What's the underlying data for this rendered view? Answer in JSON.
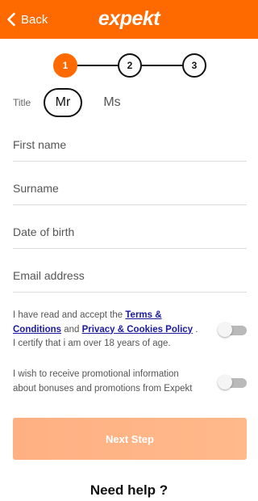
{
  "header": {
    "back_label": "Back",
    "logo_text": "expekt",
    "brand_color": "#ff6a00"
  },
  "stepper": {
    "steps": [
      "1",
      "2",
      "3"
    ],
    "current": 1
  },
  "title_field": {
    "label": "Title",
    "options": [
      "Mr",
      "Ms"
    ],
    "selected": "Mr"
  },
  "form": {
    "first_name": {
      "placeholder": "First name",
      "value": ""
    },
    "surname": {
      "placeholder": "Surname",
      "value": ""
    },
    "date_of_birth": {
      "placeholder": "Date of birth",
      "value": ""
    },
    "email": {
      "placeholder": "Email address",
      "value": ""
    }
  },
  "consents": {
    "terms": {
      "text_before": "I have read and accept the ",
      "link1": "Terms & Conditions",
      "text_mid": " and ",
      "link2": "Privacy & Cookies Policy",
      "text_after": " . I certify that i am over 18 years of age.",
      "checked": false
    },
    "promo": {
      "text": "I wish to receive promotional information about bonuses and promotions from Expekt",
      "checked": false
    }
  },
  "next_button": {
    "label": "Next Step"
  },
  "help": {
    "label": "Need help ?"
  }
}
